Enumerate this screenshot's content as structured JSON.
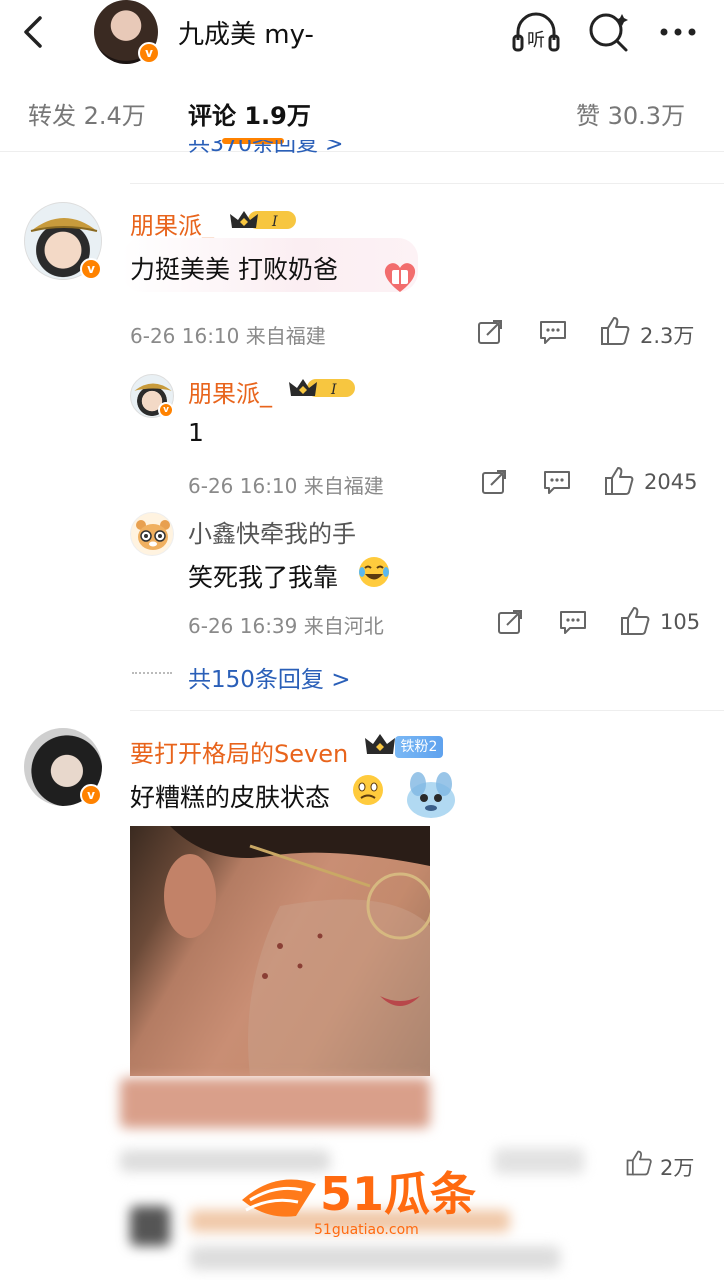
{
  "header": {
    "title": "九成美 my-",
    "listen_label": "听"
  },
  "tabs": [
    {
      "label": "转发 2.4万"
    },
    {
      "label": "评论 1.9万"
    },
    {
      "label": "赞 30.3万"
    }
  ],
  "partial_reply_link": "共370条回复 >",
  "comments": [
    {
      "username": "朋果派_",
      "text": "力挺美美 打败奶爸",
      "meta": "6-26 16:10 来自福建",
      "likes": "2.3万",
      "replies": [
        {
          "username": "朋果派_",
          "text": "1",
          "meta": "6-26 16:10 来自福建",
          "likes": "2045"
        },
        {
          "username": "小鑫快牵我的手",
          "text": "笑死我了我靠",
          "meta": "6-26 16:39 来自河北",
          "likes": "105"
        }
      ],
      "more_replies": "共150条回复 >"
    },
    {
      "username": "要打开格局的Seven",
      "fan_badge": "铁粉2",
      "text": "好糟糕的皮肤状态",
      "likes": "2万"
    }
  ],
  "watermark": {
    "logo_text": "51瓜条",
    "url": "51guatiao.com"
  },
  "colors": {
    "accent": "#ff8200",
    "username": "#e8641c",
    "link": "#2a5fb8"
  }
}
